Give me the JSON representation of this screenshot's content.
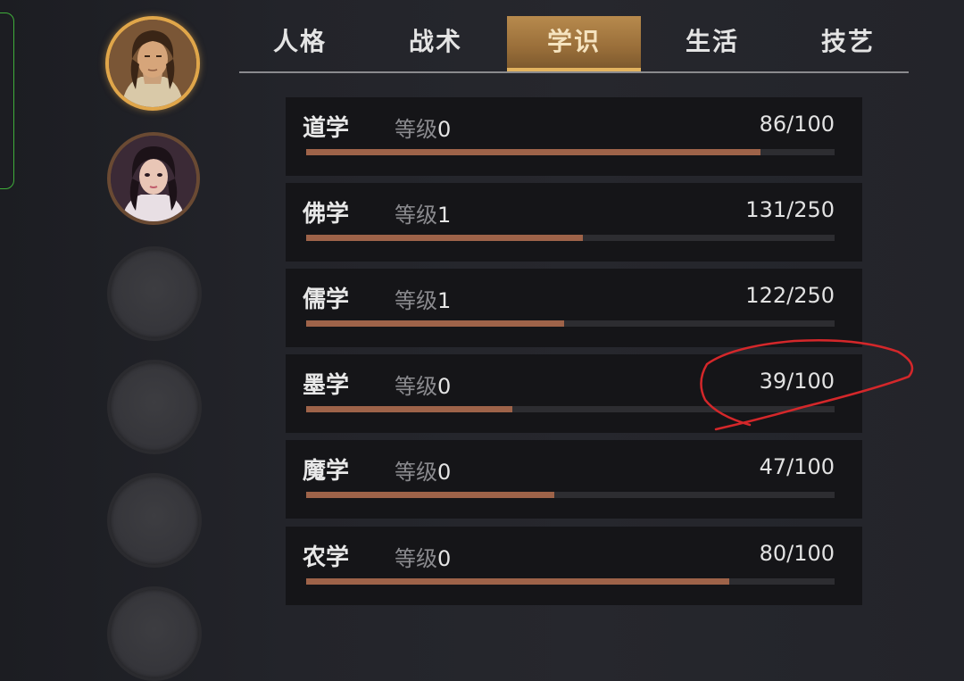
{
  "tabs": [
    {
      "label": "人格",
      "active": false
    },
    {
      "label": "战术",
      "active": false
    },
    {
      "label": "学识",
      "active": true
    },
    {
      "label": "生活",
      "active": false
    },
    {
      "label": "技艺",
      "active": false
    }
  ],
  "level_prefix": "等级",
  "skills": [
    {
      "name": "道学",
      "level": "0",
      "progress": "86/100",
      "fraction": 0.86
    },
    {
      "name": "佛学",
      "level": "1",
      "progress": "131/250",
      "fraction": 0.524
    },
    {
      "name": "儒学",
      "level": "1",
      "progress": "122/250",
      "fraction": 0.488
    },
    {
      "name": "墨学",
      "level": "0",
      "progress": "39/100",
      "fraction": 0.39
    },
    {
      "name": "魔学",
      "level": "0",
      "progress": "47/100",
      "fraction": 0.47
    },
    {
      "name": "农学",
      "level": "0",
      "progress": "80/100",
      "fraction": 0.8
    }
  ],
  "colors": {
    "accent_gold": "#e0a64a",
    "bar_fill": "#9e6349",
    "annotation_red": "#d4272a",
    "frame_green": "#3fae3a"
  }
}
